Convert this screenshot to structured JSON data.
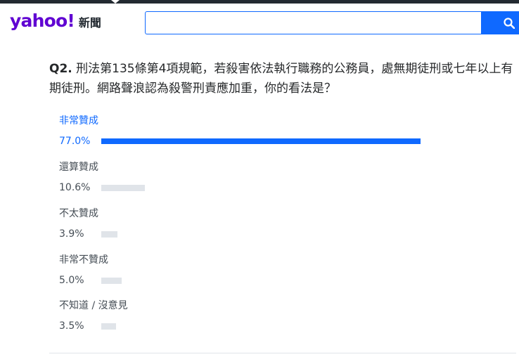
{
  "header": {
    "brand": "yahoo!",
    "section": "新聞",
    "search_value": "",
    "search_icon": "search-icon",
    "brand_color": "#6001d2",
    "accent_color": "#0f69ff"
  },
  "poll": {
    "question_number": "Q2.",
    "question_text": "刑法第135條第4項規範，若殺害依法執行職務的公務員，處無期徒刑或七年以上有期徒刑。網路聲浪認為殺警刑責應加重，你的看法是？",
    "options": [
      {
        "label": "非常贊成",
        "percent_text": "77.0%",
        "percent": 77.0,
        "leader": true
      },
      {
        "label": "還算贊成",
        "percent_text": "10.6%",
        "percent": 10.6,
        "leader": false
      },
      {
        "label": "不太贊成",
        "percent_text": "3.9%",
        "percent": 3.9,
        "leader": false
      },
      {
        "label": "非常不贊成",
        "percent_text": "5.0%",
        "percent": 5.0,
        "leader": false
      },
      {
        "label": "不知道 / 沒意見",
        "percent_text": "3.5%",
        "percent": 3.5,
        "leader": false
      }
    ]
  }
}
